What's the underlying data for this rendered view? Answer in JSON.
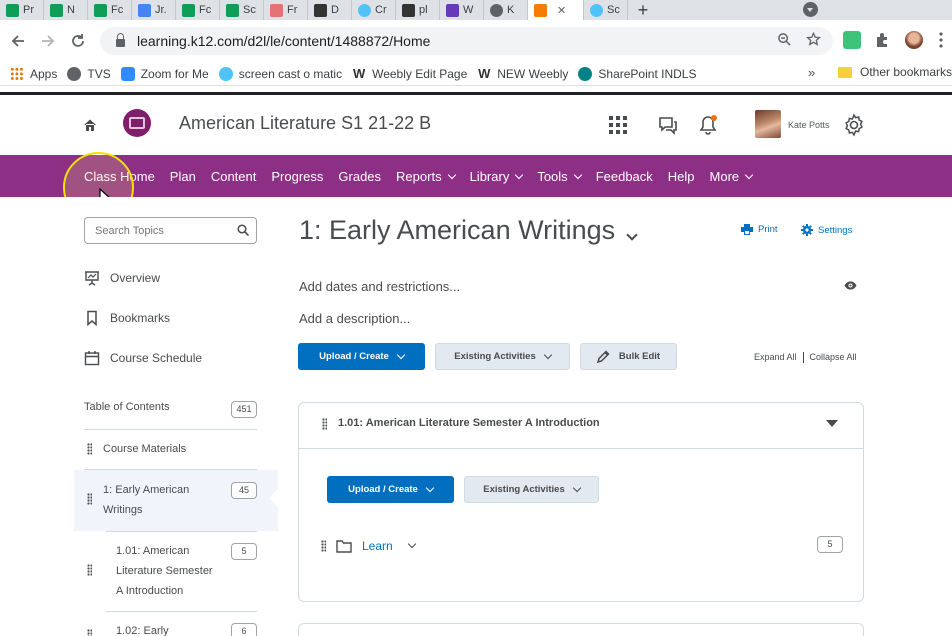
{
  "browser": {
    "tabs": [
      {
        "label": "Pr",
        "icon": "sheets-icon",
        "color": "#0f9d58"
      },
      {
        "label": "N",
        "icon": "sheets-icon",
        "color": "#0f9d58"
      },
      {
        "label": "Fc",
        "icon": "sheets-icon",
        "color": "#0f9d58"
      },
      {
        "label": "Jr.",
        "icon": "docs-icon",
        "color": "#4285f4"
      },
      {
        "label": "Fc",
        "icon": "sheets-icon",
        "color": "#0f9d58"
      },
      {
        "label": "Sc",
        "icon": "sheets-icon",
        "color": "#0f9d58"
      },
      {
        "label": "Fr",
        "icon": "pig-icon",
        "color": "#e57373"
      },
      {
        "label": "D",
        "icon": "weebly-icon",
        "color": "#333333"
      },
      {
        "label": "Cr",
        "icon": "screencast-icon",
        "color": "#4fc3f7"
      },
      {
        "label": "pl",
        "icon": "weebly-icon",
        "color": "#333333"
      },
      {
        "label": "W",
        "icon": "forms-icon",
        "color": "#673ab7"
      },
      {
        "label": "K",
        "icon": "globe-icon",
        "color": "#5f6368"
      },
      {
        "label": "",
        "icon": "d2l-icon",
        "color": "#f57c00"
      },
      {
        "label": "Sc",
        "icon": "screencast-icon",
        "color": "#4fc3f7"
      }
    ],
    "new_tab": "+",
    "url": "learning.k12.com/d2l/le/content/1488872/Home",
    "bookmarks": [
      {
        "label": "Apps",
        "icon": "apps-grid-icon",
        "color": "#e37400"
      },
      {
        "label": "TVS",
        "icon": "globe-icon",
        "color": "#5f6368"
      },
      {
        "label": "Zoom for Me",
        "icon": "zoom-icon",
        "color": "#2d8cff"
      },
      {
        "label": "screen cast o matic",
        "icon": "screencast-icon",
        "color": "#4fc3f7"
      },
      {
        "label": "Weebly Edit Page",
        "icon": "weebly-icon",
        "color": "#333333"
      },
      {
        "label": "NEW Weebly",
        "icon": "weebly-icon",
        "color": "#333333"
      },
      {
        "label": "SharePoint INDLS",
        "icon": "sharepoint-icon",
        "color": "#038387"
      }
    ],
    "bookmarks_more": "»",
    "other_bookmarks": "Other bookmarks"
  },
  "header": {
    "course_title": "American Literature S1 21-22 B",
    "user_name": "Kate Potts"
  },
  "nav": {
    "items": [
      {
        "label": "Class Home",
        "has_menu": false
      },
      {
        "label": "Plan",
        "has_menu": false
      },
      {
        "label": "Content",
        "has_menu": false
      },
      {
        "label": "Progress",
        "has_menu": false
      },
      {
        "label": "Grades",
        "has_menu": false
      },
      {
        "label": "Reports",
        "has_menu": true
      },
      {
        "label": "Library",
        "has_menu": true
      },
      {
        "label": "Tools",
        "has_menu": true
      },
      {
        "label": "Feedback",
        "has_menu": false
      },
      {
        "label": "Help",
        "has_menu": false
      },
      {
        "label": "More",
        "has_menu": true
      }
    ],
    "bar_color": "#8c2f85"
  },
  "sidebar": {
    "search_placeholder": "Search Topics",
    "overview": "Overview",
    "bookmarks": "Bookmarks",
    "course_schedule": "Course Schedule",
    "toc_label": "Table of Contents",
    "toc_count": "451",
    "course_materials": "Course Materials",
    "unit1_line1": "1: Early American",
    "unit1_line2": "Writings",
    "unit1_count": "45",
    "lesson101_line1": "1.01: American",
    "lesson101_line2": "Literature Semester",
    "lesson101_line3": "A Introduction",
    "lesson101_count": "5",
    "lesson102_line1": "1.02: Early",
    "lesson102_count": "6"
  },
  "main": {
    "unit_title": "1: Early American Writings",
    "print_label": "Print",
    "settings_label": "Settings",
    "add_dates": "Add dates and restrictions...",
    "add_description": "Add a description...",
    "upload_create": "Upload / Create",
    "existing_activities": "Existing Activities",
    "bulk_edit": "Bulk Edit",
    "expand_all": "Expand All",
    "collapse_all": "Collapse All",
    "module_title": "1.01: American Literature Semester A Introduction",
    "module_upload_create": "Upload / Create",
    "module_existing_activities": "Existing Activities",
    "learn_label": "Learn",
    "learn_count": "5"
  },
  "colors": {
    "primary_blue": "#006fbf",
    "nav_purple": "#8c2f85",
    "cursor_highlight": "#f2e200"
  }
}
